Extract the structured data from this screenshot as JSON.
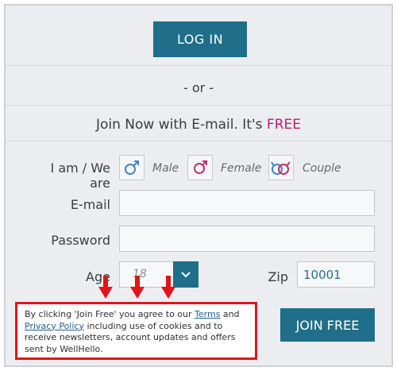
{
  "login": {
    "label": "LOG IN"
  },
  "divider": {
    "or_text": "- or -"
  },
  "join_now": {
    "prefix": "Join Now with E-mail. It's ",
    "free": "FREE"
  },
  "gender": {
    "label": "I am / We are",
    "options": [
      {
        "label": "Male",
        "icon": "male-icon",
        "color": "#3f86c8"
      },
      {
        "label": "Female",
        "icon": "female-icon",
        "color": "#c42f6f"
      },
      {
        "label": "Couple",
        "icon": "couple-icon",
        "color": "#3f86c8"
      }
    ]
  },
  "form": {
    "email_label": "E-mail",
    "email_value": "",
    "password_label": "Password",
    "password_value": "",
    "age_label": "Age",
    "age_value": "18",
    "zip_label": "Zip",
    "zip_value": "10001"
  },
  "join_button": {
    "label": "JOIN FREE"
  },
  "notice": {
    "text_1": "By clicking 'Join Free' you agree to our ",
    "terms": "Terms",
    "text_2": " and ",
    "privacy": "Privacy Policy",
    "text_3": " including use of cookies and to receive newsletters, account updates and offers sent by WellHello."
  },
  "colors": {
    "accent": "#1f6f8a",
    "free": "#b81f6e",
    "highlight": "#e2141b"
  }
}
